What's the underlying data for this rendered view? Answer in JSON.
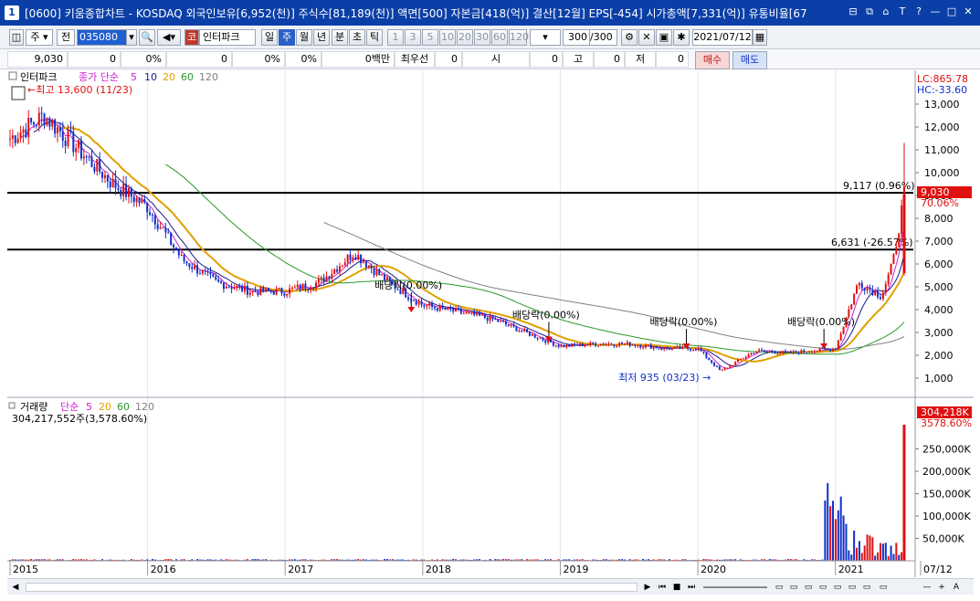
{
  "window": {
    "icon_label": "1",
    "title": "[0600] 키움종합차트 - KOSDAQ 외국인보유[6,952(천)] 주식수[81,189(천)] 액면[500] 자본금[418(억)] 결산[12월] EPS[-454] 시가총액[7,331(억)] 유통비율[67",
    "controls": [
      "⊟",
      "⧉",
      "⌂",
      "T",
      "?",
      "—",
      "□",
      "✕"
    ]
  },
  "toolbar": {
    "period_label": "주",
    "prev_label": "전",
    "stock_code": "035080",
    "stock_badge": "코",
    "stock_name": "인터파크",
    "periods": [
      "일",
      "주",
      "월",
      "년",
      "분",
      "초",
      "틱"
    ],
    "active_period": "주",
    "intervals": [
      "1",
      "3",
      "5",
      "10",
      "20",
      "30",
      "60",
      "120"
    ],
    "count_value": "300",
    "count_total": "/300",
    "date_value": "2021/07/12"
  },
  "infobar": {
    "cells": [
      "9,030",
      "0",
      "0%",
      "0",
      "0%",
      "0%",
      "0백만",
      "최우선",
      "0",
      "시",
      "0",
      "고",
      "0",
      "저",
      "0"
    ],
    "buy_label": "매수",
    "sell_label": "매도"
  },
  "price_panel": {
    "name_label": "인터파크",
    "legend_prefix": "종가 단순",
    "ma_periods": [
      "5",
      "10",
      "20",
      "60",
      "120"
    ],
    "lc_label": "LC:865.78",
    "hc_label": "HC:-33.60",
    "high_marker": "최고 13,600 (11/23)",
    "low_marker": "최저 935 (03/23)",
    "y_ticks": [
      "13,000",
      "12,000",
      "11,000",
      "10,000",
      "9,000",
      "8,000",
      "7,000",
      "6,000",
      "5,000",
      "4,000",
      "3,000",
      "2,000",
      "1,000"
    ],
    "current_price": "9,030",
    "current_change": "70.06%",
    "hline1_label": "9,117 (0.96%)",
    "hline2_label": "6,631 (-26.57%)",
    "dividends": [
      "배당락(0.00%)",
      "배당락(0.00%)",
      "배당락(0.00%)",
      "배당락(0.00%)"
    ]
  },
  "volume_panel": {
    "name_label": "거래량",
    "legend_prefix": "단순",
    "ma_periods": [
      "5",
      "20",
      "60",
      "120"
    ],
    "volume_text": "304,217,552주(3,578.60%)",
    "current_volume": "304,218K",
    "current_pct": "3578.60%",
    "y_ticks": [
      "250,000K",
      "200,000K",
      "150,000K",
      "100,000K",
      "50,000K"
    ]
  },
  "x_axis": {
    "labels": [
      "2015",
      "2016",
      "2017",
      "2018",
      "2019",
      "2020",
      "2021",
      "07/12"
    ]
  },
  "colors": {
    "title_bg": "#0b3fa8",
    "up": "#e01010",
    "down": "#1030c8",
    "ma5": "#d020d0",
    "ma10": "#1a1a8a",
    "ma20": "#e0a000",
    "ma60": "#2a9a2a",
    "ma120": "#808080"
  },
  "chart_data": {
    "type": "candlestick",
    "title": "",
    "x_range": [
      "2015",
      "2021/07/12"
    ],
    "y_range": [
      0,
      13600
    ],
    "price": {
      "x": [
        "2015-01",
        "2015-04",
        "2015-07",
        "2015-10",
        "2016-01",
        "2016-04",
        "2016-07",
        "2016-10",
        "2017-01",
        "2017-04",
        "2017-07",
        "2017-10",
        "2018-01",
        "2018-04",
        "2018-07",
        "2018-10",
        "2019-01",
        "2019-04",
        "2019-07",
        "2019-10",
        "2020-01",
        "2020-03",
        "2020-06",
        "2020-09",
        "2021-01",
        "2021-03",
        "2021-05",
        "2021-06",
        "2021-07"
      ],
      "close": [
        11500,
        12500,
        11000,
        9500,
        8500,
        6200,
        5200,
        4800,
        4800,
        5200,
        6500,
        5200,
        4200,
        3900,
        3600,
        3000,
        2400,
        2500,
        2500,
        2300,
        2300,
        1300,
        2200,
        2100,
        2300,
        5200,
        4600,
        6000,
        9030
      ]
    },
    "horizontal_lines": [
      9117,
      6631
    ],
    "annotations": [
      "최고 13,600 (11/23)",
      "최저 935 (03/23)"
    ],
    "volume": {
      "y_range": [
        0,
        300000
      ],
      "unit": "K",
      "last": 304218
    }
  }
}
